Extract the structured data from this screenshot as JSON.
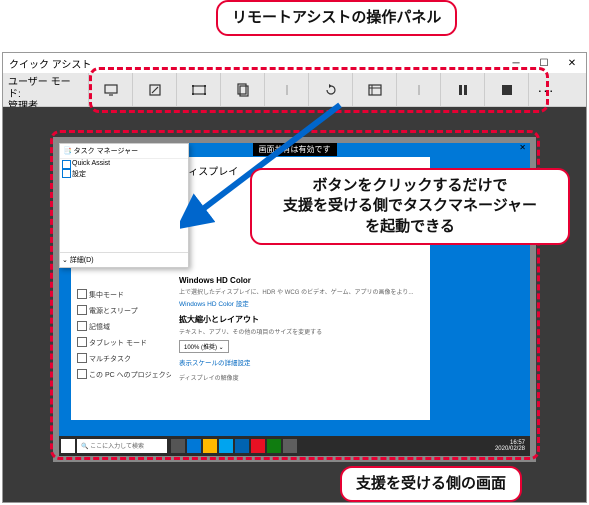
{
  "callouts": {
    "top": "リモートアシストの操作パネル",
    "middle": "ボタンをクリックするだけで\n支援を受ける側でタスクマネージャー\nを起動できる",
    "bottom": "支援を受ける側の画面"
  },
  "titlebar": {
    "title": "クイック アシスト"
  },
  "usermode": {
    "label": "ユーザー モード:",
    "value": "管理者"
  },
  "toolbar_icons": [
    "monitor-icon",
    "annotate-icon",
    "fit-screen-icon",
    "task-manager-icon",
    "divider-icon",
    "restart-icon",
    "actual-size-icon",
    "divider-icon",
    "pause-icon",
    "stop-icon"
  ],
  "remote": {
    "top_label": "画面共有は有効です",
    "task_manager": {
      "title": "タスク マネージャー",
      "items": [
        "Quick Assist",
        "設定"
      ],
      "footer": "詳細(D)"
    },
    "settings_sidebar": [
      "集中モード",
      "電源とスリープ",
      "記憶域",
      "タブレット モード",
      "マルチタスク",
      "この PC へのプロジェクション"
    ],
    "settings_main": {
      "heading": "ディスプレイ",
      "hd_title": "Windows HD Color",
      "hd_desc": "上で選択したディスプレイに、HDR や WCG のビデオ、ゲーム、アプリの画像をより...",
      "hd_link": "Windows HD Color 設定",
      "scale_title": "拡大縮小とレイアウト",
      "scale_desc": "テキスト、アプリ、その他の項目のサイズを変更する",
      "scale_value": "100% (推奨)",
      "scale_link": "表示スケールの詳細設定",
      "res_label": "ディスプレイの解像度"
    },
    "taskbar": {
      "search_placeholder": "ここに入力して検索",
      "time": "16:57",
      "date": "2020/02/28"
    }
  }
}
